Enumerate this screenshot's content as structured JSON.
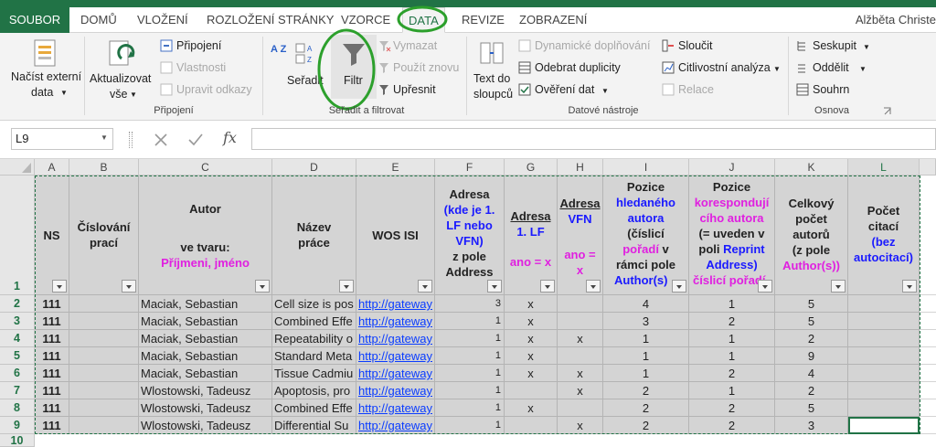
{
  "tabs": {
    "file": "SOUBOR",
    "home": "DOMŮ",
    "insert": "VLOŽENÍ",
    "layout": "ROZLOŽENÍ STRÁNKY",
    "formulas": "VZORCE",
    "data": "DATA",
    "review": "REVIZE",
    "view": "ZOBRAZENÍ",
    "user": "Alžběta Christe"
  },
  "ribbon": {
    "external_1": "Načíst externí",
    "external_2": "data",
    "refresh_1": "Aktualizovat",
    "refresh_2": "vše",
    "connections": "Připojení",
    "properties": "Vlastnosti",
    "edit_links": "Upravit odkazy",
    "group_connections": "Připojení",
    "sort_az": "A Z",
    "sort": "Seřadit",
    "filter": "Filtr",
    "clear": "Vymazat",
    "reapply": "Použít znovu",
    "advanced": "Upřesnit",
    "group_sort_filter": "Seřadit a filtrovat",
    "text_columns_1": "Text do",
    "text_columns_2": "sloupců",
    "flash_fill": "Dynamické doplňování",
    "remove_dup": "Odebrat duplicity",
    "validation": "Ověření dat",
    "consolidate": "Sloučit",
    "whatif": "Citlivostní analýza",
    "relationships": "Relace",
    "group_data_tools": "Datové nástroje",
    "group": "Seskupit",
    "ungroup": "Oddělit",
    "subtotal": "Souhrn",
    "group_outline": "Osnova"
  },
  "formula_bar": {
    "name_box": "L9",
    "fx": "fx",
    "value": ""
  },
  "columns": [
    "A",
    "B",
    "C",
    "D",
    "E",
    "F",
    "G",
    "H",
    "I",
    "J",
    "K",
    "L"
  ],
  "header": {
    "a": "NS",
    "b_1": "Číslování",
    "b_2": "prací",
    "c_1": "Autor",
    "c_2": "ve tvaru:",
    "c_3": "Příjmeni, jméno",
    "d_1": "Název",
    "d_2": "práce",
    "e": "WOS ISI",
    "f_1": "Adresa",
    "f_2": "(kde je 1.",
    "f_3": "LF nebo",
    "f_4": "VFN)",
    "f_5": "z pole",
    "f_6": "Address",
    "g_1": "Adresa",
    "g_2": "1. LF",
    "g_3": "ano = x",
    "h_1": "Adresa",
    "h_2": "VFN",
    "h_3": "ano =",
    "h_4": "x",
    "i_1": "Pozice",
    "i_2": "hledaného",
    "i_3": "autora",
    "i_4": "(číslicí",
    "i_5": "pořadí",
    "i_5b": " v",
    "i_6": "rámci pole",
    "i_7": "Author(s)",
    "j_1": "Pozice",
    "j_2": "korespondují",
    "j_3": "cího autora",
    "j_4": "(= uveden v",
    "j_5": "poli ",
    "j_5b": "Reprint",
    "j_6": "Address)",
    "j_7": "číslicí pořadí",
    "k_1": "Celkový",
    "k_2": "počet",
    "k_3": "autorů",
    "k_4": "(z pole",
    "k_5": "Author(s))",
    "l_1": "Počet",
    "l_2": "citací",
    "l_3": "(bez",
    "l_4": "autocitací)"
  },
  "rows": [
    {
      "num": "2",
      "ns": "111",
      "author": "Maciak, Sebastian",
      "title": "Cell size is pos",
      "wos": "http://gateway",
      "addr": "3",
      "lf": "x",
      "vfn": "",
      "pos": "4",
      "corr": "1",
      "total": "5"
    },
    {
      "num": "3",
      "ns": "111",
      "author": "Maciak, Sebastian",
      "title": "Combined Effe",
      "wos": "http://gateway",
      "addr": "1",
      "lf": "x",
      "vfn": "",
      "pos": "3",
      "corr": "2",
      "total": "5"
    },
    {
      "num": "4",
      "ns": "111",
      "author": "Maciak, Sebastian",
      "title": "Repeatability o",
      "wos": "http://gateway",
      "addr": "1",
      "lf": "x",
      "vfn": "x",
      "pos": "1",
      "corr": "1",
      "total": "2"
    },
    {
      "num": "5",
      "ns": "111",
      "author": "Maciak, Sebastian",
      "title": "Standard Meta",
      "wos": "http://gateway",
      "addr": "1",
      "lf": "x",
      "vfn": "",
      "pos": "1",
      "corr": "1",
      "total": "9"
    },
    {
      "num": "6",
      "ns": "111",
      "author": "Maciak, Sebastian",
      "title": "Tissue Cadmiu",
      "wos": "http://gateway",
      "addr": "1",
      "lf": "x",
      "vfn": "x",
      "pos": "1",
      "corr": "2",
      "total": "4"
    },
    {
      "num": "7",
      "ns": "111",
      "author": "Wlostowski, Tadeusz",
      "title": "Apoptosis, pro",
      "wos": "http://gateway",
      "addr": "1",
      "lf": "",
      "vfn": "x",
      "pos": "2",
      "corr": "1",
      "total": "2"
    },
    {
      "num": "8",
      "ns": "111",
      "author": "Wlostowski, Tadeusz",
      "title": "Combined Effe",
      "wos": "http://gateway",
      "addr": "1",
      "lf": "x",
      "vfn": "",
      "pos": "2",
      "corr": "2",
      "total": "5"
    },
    {
      "num": "9",
      "ns": "111",
      "author": "Wlostowski, Tadeusz",
      "title": "Differential Su",
      "wos": "http://gateway",
      "addr": "1",
      "lf": "",
      "vfn": "x",
      "pos": "2",
      "corr": "2",
      "total": "3"
    }
  ],
  "row_1": "1",
  "row_10": "10",
  "colors": {
    "accent": "#217346",
    "highlight": "#2ca02c",
    "blue_text": "#1a1aff",
    "magenta_text": "#e020e0"
  }
}
